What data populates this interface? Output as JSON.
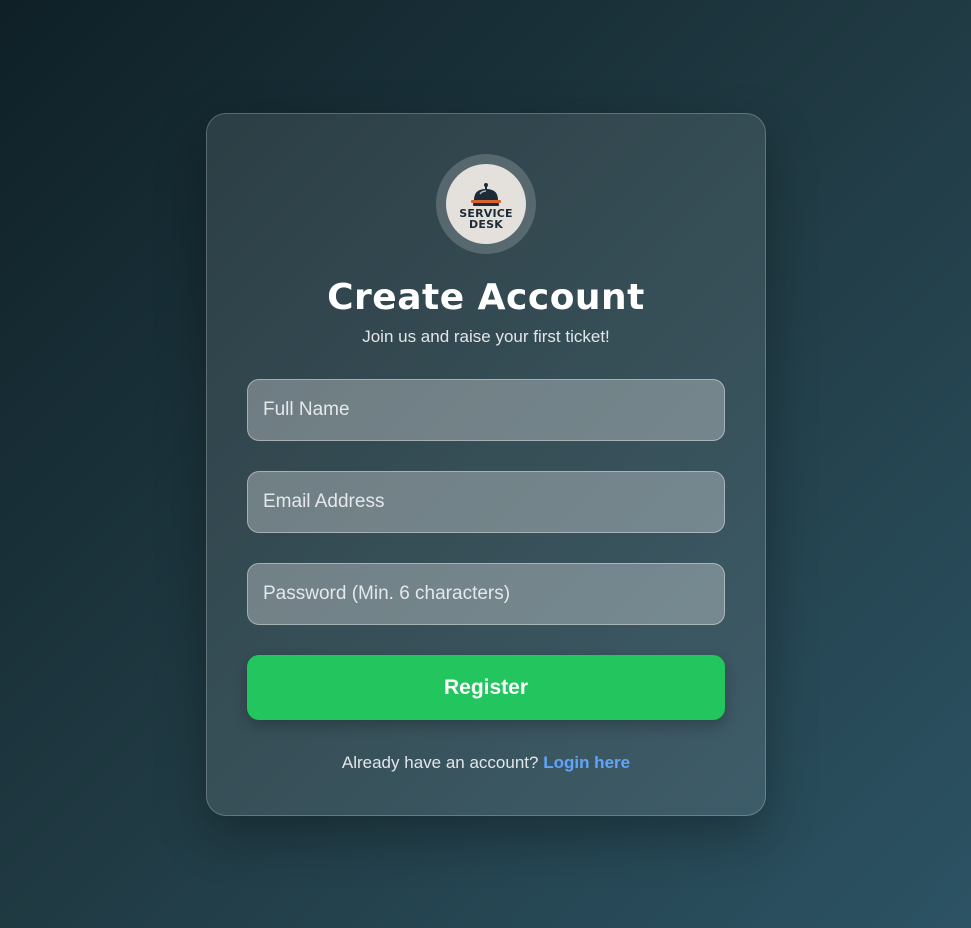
{
  "brand": {
    "logo_line1": "SERVICE",
    "logo_line2": "DESK"
  },
  "header": {
    "title": "Create Account",
    "subtitle": "Join us and raise your first ticket!"
  },
  "form": {
    "full_name": {
      "placeholder": "Full Name",
      "value": ""
    },
    "email": {
      "placeholder": "Email Address",
      "value": ""
    },
    "password": {
      "placeholder": "Password (Min. 6 characters)",
      "value": ""
    },
    "register_label": "Register"
  },
  "footer": {
    "prompt": "Already have an account?",
    "link_label": "Login here"
  },
  "colors": {
    "accent_green": "#22c55e",
    "link_blue": "#60a5fa",
    "logo_navy": "#1d2b38",
    "logo_orange": "#d9622b"
  },
  "icons": {
    "logo": "service-bell-icon"
  }
}
